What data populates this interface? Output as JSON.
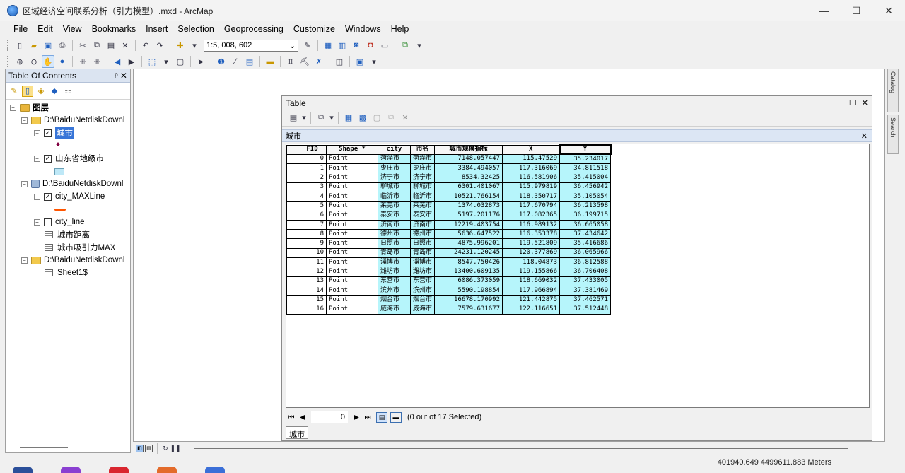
{
  "window": {
    "title": "区域经济空间联系分析（引力模型）.mxd - ArcMap",
    "min": "—",
    "max": "☐",
    "close": "✕"
  },
  "menu": [
    "File",
    "Edit",
    "View",
    "Bookmarks",
    "Insert",
    "Selection",
    "Geoprocessing",
    "Customize",
    "Windows",
    "Help"
  ],
  "toolbar": {
    "scale": "1:5, 008, 602"
  },
  "toc": {
    "title": "Table Of Contents",
    "pin": "ᵖ ✕",
    "root": "图层",
    "rows": [
      {
        "type": "folder",
        "label": "D:\\BaiduNetdiskDownl"
      },
      {
        "type": "layer",
        "label": "城市",
        "checked": true,
        "selected": true
      },
      {
        "type": "folder",
        "label": "D:\\BaiduNetdiskDownl"
      },
      {
        "type": "layer",
        "label": "山东省地级市",
        "checked": true
      },
      {
        "type": "folder",
        "label": "D:\\BaiduNetdiskDownl"
      },
      {
        "type": "layer",
        "label": "city_MAXLine",
        "checked": true
      },
      {
        "type": "layer",
        "label": "city_line",
        "checked": false
      },
      {
        "type": "table",
        "label": "城市距离"
      },
      {
        "type": "table",
        "label": "城市吸引力MAX"
      },
      {
        "type": "folder",
        "label": "D:\\BaiduNetdiskDownl"
      },
      {
        "type": "table",
        "label": "Sheet1$"
      }
    ]
  },
  "dock": {
    "catalog": "Catalog",
    "search": "Search"
  },
  "table": {
    "window_title": "Table",
    "tab_name": "城市",
    "columns": [
      "FID",
      "Shape *",
      "city",
      "市名",
      "城市规模指标",
      "X",
      "Y"
    ],
    "rows": [
      [
        "0",
        "Point",
        "菏泽市",
        "菏泽市",
        "7148.057447",
        "115.47529",
        "35.234017"
      ],
      [
        "1",
        "Point",
        "枣庄市",
        "枣庄市",
        "3384.494057",
        "117.316069",
        "34.811518"
      ],
      [
        "2",
        "Point",
        "济宁市",
        "济宁市",
        "8534.32425",
        "116.581906",
        "35.415004"
      ],
      [
        "3",
        "Point",
        "聊城市",
        "聊城市",
        "6301.401067",
        "115.979819",
        "36.456942"
      ],
      [
        "4",
        "Point",
        "临沂市",
        "临沂市",
        "10521.766154",
        "118.350717",
        "35.105054"
      ],
      [
        "5",
        "Point",
        "莱芜市",
        "莱芜市",
        "1374.032873",
        "117.670794",
        "36.213598"
      ],
      [
        "6",
        "Point",
        "泰安市",
        "泰安市",
        "5197.201176",
        "117.082365",
        "36.199715"
      ],
      [
        "7",
        "Point",
        "济南市",
        "济南市",
        "12219.403754",
        "116.989132",
        "36.665058"
      ],
      [
        "8",
        "Point",
        "德州市",
        "德州市",
        "5636.647522",
        "116.353378",
        "37.434642"
      ],
      [
        "9",
        "Point",
        "日照市",
        "日照市",
        "4875.996201",
        "119.521809",
        "35.416686"
      ],
      [
        "10",
        "Point",
        "青岛市",
        "青岛市",
        "24231.120245",
        "120.377869",
        "36.065966"
      ],
      [
        "11",
        "Point",
        "淄博市",
        "淄博市",
        "8547.750426",
        "118.04873",
        "36.812588"
      ],
      [
        "12",
        "Point",
        "潍坊市",
        "潍坊市",
        "13400.609135",
        "119.155866",
        "36.706408"
      ],
      [
        "13",
        "Point",
        "东营市",
        "东营市",
        "6086.373059",
        "118.669032",
        "37.433005"
      ],
      [
        "14",
        "Point",
        "滨州市",
        "滨州市",
        "5590.198854",
        "117.966894",
        "37.381469"
      ],
      [
        "15",
        "Point",
        "烟台市",
        "烟台市",
        "16678.170992",
        "121.442875",
        "37.462571"
      ],
      [
        "16",
        "Point",
        "威海市",
        "威海市",
        "7579.631677",
        "122.116651",
        "37.512448"
      ]
    ],
    "record_position": "0",
    "selection_status": "(0 out of 17 Selected)",
    "bottom_tab": "城市"
  },
  "status": {
    "coordinates": "401940.649  4499611.883 Meters"
  }
}
